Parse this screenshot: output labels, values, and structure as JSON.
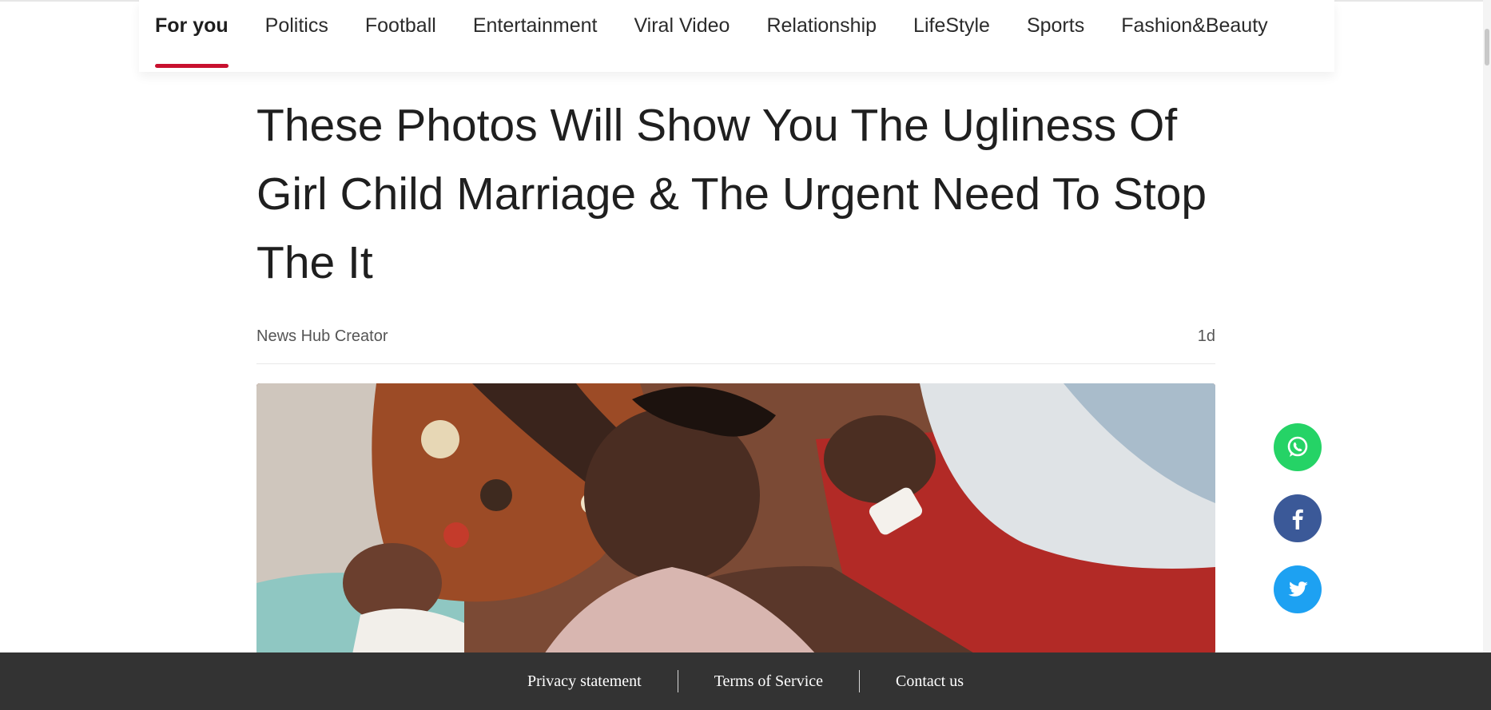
{
  "nav": {
    "tabs": [
      {
        "label": "For you",
        "active": true
      },
      {
        "label": "Politics"
      },
      {
        "label": "Football"
      },
      {
        "label": "Entertainment"
      },
      {
        "label": "Viral Video"
      },
      {
        "label": "Relationship"
      },
      {
        "label": "LifeStyle"
      },
      {
        "label": "Sports"
      },
      {
        "label": "Fashion&Beauty"
      }
    ],
    "accent_color": "#c8102e"
  },
  "article": {
    "title": "These Photos Will Show You The Ugliness Of Girl Child Marriage & The Urgent Need To Stop The It",
    "author": "News Hub Creator",
    "age": "1d"
  },
  "share": {
    "buttons": [
      {
        "icon": "whatsapp-icon",
        "color": "#25d366"
      },
      {
        "icon": "facebook-icon",
        "color": "#3b5998"
      },
      {
        "icon": "twitter-icon",
        "color": "#1da1f2"
      }
    ]
  },
  "footer": {
    "links": [
      "Privacy statement",
      "Terms of Service",
      "Contact us"
    ],
    "background": "#333333"
  }
}
